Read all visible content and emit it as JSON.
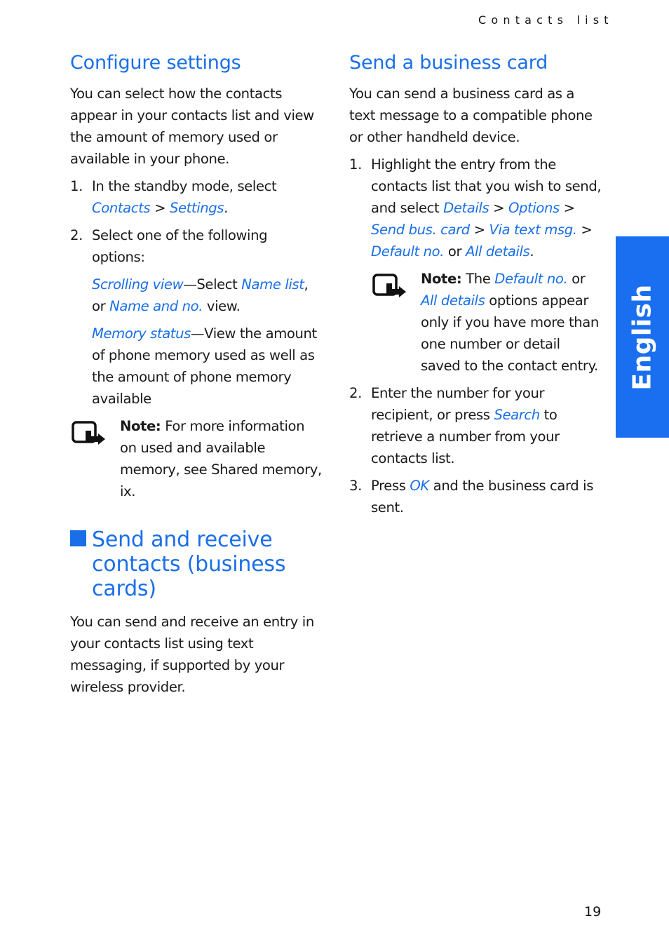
{
  "running_head": "Contacts list",
  "side_tab": {
    "label": "English",
    "color": "#1a6ff0"
  },
  "accent_color": "#1a6fe8",
  "page_number": "19",
  "left_column": {
    "configure": {
      "title": "Configure settings",
      "intro": "You can select how the contacts appear in your contacts list and view the amount of memory used or available in your phone.",
      "step1": {
        "num": "1.",
        "pre": "In the standby mode, select",
        "link1": "Contacts",
        "sep": " > ",
        "link2": "Settings",
        "post": "."
      },
      "step2": {
        "num": "2.",
        "text": "Select one of the following options:"
      },
      "option1": {
        "link": "Scrolling view",
        "dash": "—Select ",
        "link2": "Name list",
        "mid": ", or ",
        "link3": "Name and no.",
        "post": " view."
      },
      "option2": {
        "link": "Memory status",
        "text": "—View the amount of phone memory used as well as the amount of phone memory available"
      },
      "note": {
        "label": "Note:",
        "text": " For more information on used and available memory, see Shared memory, ix."
      }
    },
    "send_receive": {
      "title": "Send and receive contacts (business cards)",
      "body": "You can send and receive an entry in your contacts list using text messaging, if supported by your wireless provider."
    }
  },
  "right_column": {
    "title": "Send a business card",
    "intro": "You can send a business card as a text message to a compatible phone or other handheld device.",
    "step1": {
      "num": "1.",
      "pre": "Highlight the entry from the contacts list that you wish to send, and select ",
      "link1": "Details",
      "sep1": " > ",
      "link2": "Options",
      "sep2": " > ",
      "link3": "Send bus. card",
      "sep3": " > ",
      "link4": "Via text msg.",
      "sep4": " > ",
      "link5": "Default no.",
      "or": " or ",
      "link6": "All details",
      "post": "."
    },
    "note": {
      "label": "Note:",
      "pre": " The ",
      "link1": "Default no.",
      "or": " or ",
      "link2": "All details",
      "post": " options appear only if you have more than one number or detail saved to the contact entry."
    },
    "step2": {
      "num": "2.",
      "pre": "Enter the number for your recipient, or press ",
      "link": "Search",
      "post": " to retrieve a number from your contacts list."
    },
    "step3": {
      "num": "3.",
      "pre": "Press ",
      "link": "OK",
      "post": " and the business card is sent."
    }
  }
}
